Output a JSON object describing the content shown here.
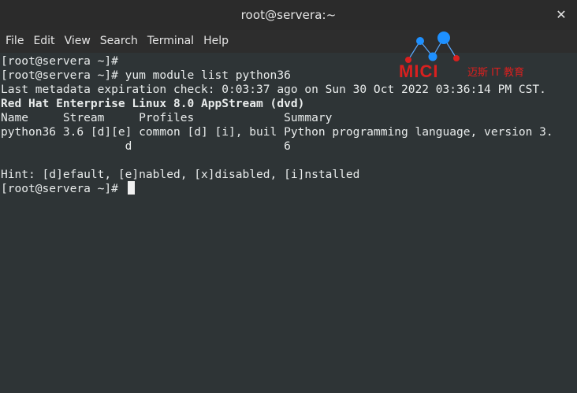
{
  "window": {
    "title": "root@servera:~",
    "close_glyph": "✕"
  },
  "menu": [
    "File",
    "Edit",
    "View",
    "Search",
    "Terminal",
    "Help"
  ],
  "terminal": {
    "lines": [
      "[root@servera ~]#",
      "[root@servera ~]# yum module list python36",
      "Last metadata expiration check: 0:03:37 ago on Sun 30 Oct 2022 03:36:14 PM CST.",
      "Red Hat Enterprise Linux 8.0 AppStream (dvd)",
      "Name     Stream     Profiles             Summary",
      "python36 3.6 [d][e] common [d] [i], buil Python programming language, version 3.",
      "                  d                      6",
      "",
      "Hint: [d]efault, [e]nabled, [x]disabled, [i]nstalled",
      "[root@servera ~]#"
    ]
  },
  "watermark": {
    "brand": "MICI",
    "cn_text": "迈斯 IT 教育",
    "color": "#d9201f",
    "dot_color": "#1e90ff"
  },
  "colors": {
    "background": "#2e3436",
    "text": "#e9ecec",
    "titlebar": "#2b2b2b"
  }
}
